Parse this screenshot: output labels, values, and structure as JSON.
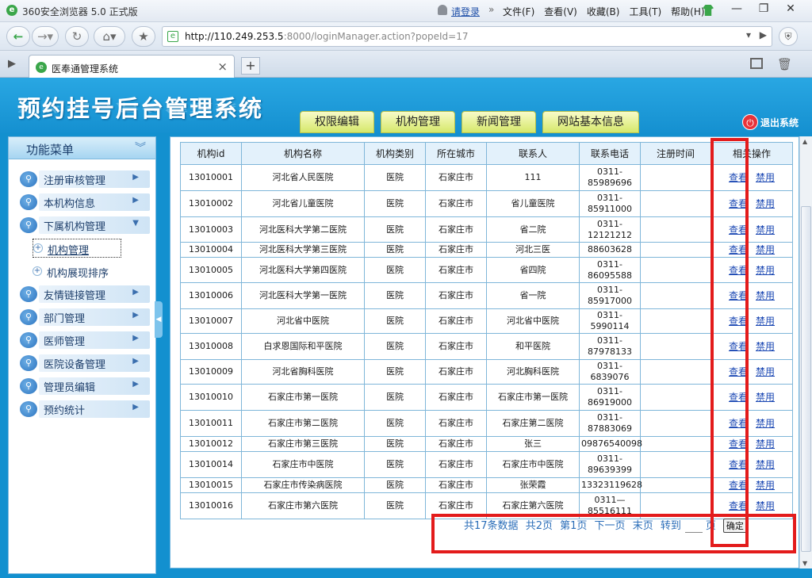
{
  "browser": {
    "app_title": "360安全浏览器 5.0 正式版",
    "login": "请登录",
    "menu": [
      "文件(F)",
      "查看(V)",
      "收藏(B)",
      "工具(T)",
      "帮助(H)"
    ],
    "url_host": "http://110.249.253.5",
    "url_rest": ":8000/loginManager.action?popeId=17",
    "tab_title": "医奉通管理系统"
  },
  "header": {
    "site_title": "预约挂号后台管理系统",
    "nav": [
      "权限编辑",
      "机构管理",
      "新闻管理",
      "网站基本信息"
    ],
    "logout": "退出系统"
  },
  "sidebar": {
    "title": "功能菜单",
    "items": [
      {
        "label": "注册审核管理"
      },
      {
        "label": "本机构信息"
      },
      {
        "label": "下属机构管理"
      },
      {
        "label": "友情链接管理"
      },
      {
        "label": "部门管理"
      },
      {
        "label": "医师管理"
      },
      {
        "label": "医院设备管理"
      },
      {
        "label": "管理员编辑"
      },
      {
        "label": "预约统计"
      }
    ],
    "subitems": [
      {
        "label": "机构管理"
      },
      {
        "label": "机构展现排序"
      }
    ]
  },
  "table": {
    "headers": [
      "机构id",
      "机构名称",
      "机构类别",
      "所在城市",
      "联系人",
      "联系电话",
      "注册时间",
      "相关操作"
    ],
    "view_label": "查看",
    "ban_label": "禁用",
    "rows": [
      {
        "id": "13010001",
        "name": "河北省人民医院",
        "type": "医院",
        "city": "石家庄市",
        "contact": "111",
        "phone": "0311-85989696",
        "reg": ""
      },
      {
        "id": "13010002",
        "name": "河北省儿童医院",
        "type": "医院",
        "city": "石家庄市",
        "contact": "省儿童医院",
        "phone": "0311-85911000",
        "reg": ""
      },
      {
        "id": "13010003",
        "name": "河北医科大学第二医院",
        "type": "医院",
        "city": "石家庄市",
        "contact": "省二院",
        "phone": "0311-12121212",
        "reg": ""
      },
      {
        "id": "13010004",
        "name": "河北医科大学第三医院",
        "type": "医院",
        "city": "石家庄市",
        "contact": "河北三医",
        "phone": "88603628",
        "reg": ""
      },
      {
        "id": "13010005",
        "name": "河北医科大学第四医院",
        "type": "医院",
        "city": "石家庄市",
        "contact": "省四院",
        "phone": "0311-86095588",
        "reg": ""
      },
      {
        "id": "13010006",
        "name": "河北医科大学第一医院",
        "type": "医院",
        "city": "石家庄市",
        "contact": "省一院",
        "phone": "0311-85917000",
        "reg": ""
      },
      {
        "id": "13010007",
        "name": "河北省中医院",
        "type": "医院",
        "city": "石家庄市",
        "contact": "河北省中医院",
        "phone": "0311-5990114",
        "reg": ""
      },
      {
        "id": "13010008",
        "name": "白求恩国际和平医院",
        "type": "医院",
        "city": "石家庄市",
        "contact": "和平医院",
        "phone": "0311-87978133",
        "reg": ""
      },
      {
        "id": "13010009",
        "name": "河北省胸科医院",
        "type": "医院",
        "city": "石家庄市",
        "contact": "河北胸科医院",
        "phone": "0311-6839076",
        "reg": ""
      },
      {
        "id": "13010010",
        "name": "石家庄市第一医院",
        "type": "医院",
        "city": "石家庄市",
        "contact": "石家庄市第一医院",
        "phone": "0311-86919000",
        "reg": ""
      },
      {
        "id": "13010011",
        "name": "石家庄市第二医院",
        "type": "医院",
        "city": "石家庄市",
        "contact": "石家庄第二医院",
        "phone": "0311-87883069",
        "reg": ""
      },
      {
        "id": "13010012",
        "name": "石家庄市第三医院",
        "type": "医院",
        "city": "石家庄市",
        "contact": "张三",
        "phone": "09876540098",
        "reg": ""
      },
      {
        "id": "13010014",
        "name": "石家庄市中医院",
        "type": "医院",
        "city": "石家庄市",
        "contact": "石家庄市中医院",
        "phone": "0311-89639399",
        "reg": ""
      },
      {
        "id": "13010015",
        "name": "石家庄市传染病医院",
        "type": "医院",
        "city": "石家庄市",
        "contact": "张荣霞",
        "phone": "13323119628",
        "reg": ""
      },
      {
        "id": "13010016",
        "name": "石家庄市第六医院",
        "type": "医院",
        "city": "石家庄市",
        "contact": "石家庄第六医院",
        "phone": "0311—85516111",
        "reg": ""
      }
    ]
  },
  "pager": {
    "total": "共17条数据",
    "pages": "共2页",
    "current": "第1页",
    "next": "下一页",
    "last": "末页",
    "goto": "转到",
    "page_unit": "页",
    "ok": "确定"
  },
  "colors": {
    "annotation": "#e31b1b",
    "header_blue": "#1590d0",
    "nav_tab": "#d6e86a"
  }
}
